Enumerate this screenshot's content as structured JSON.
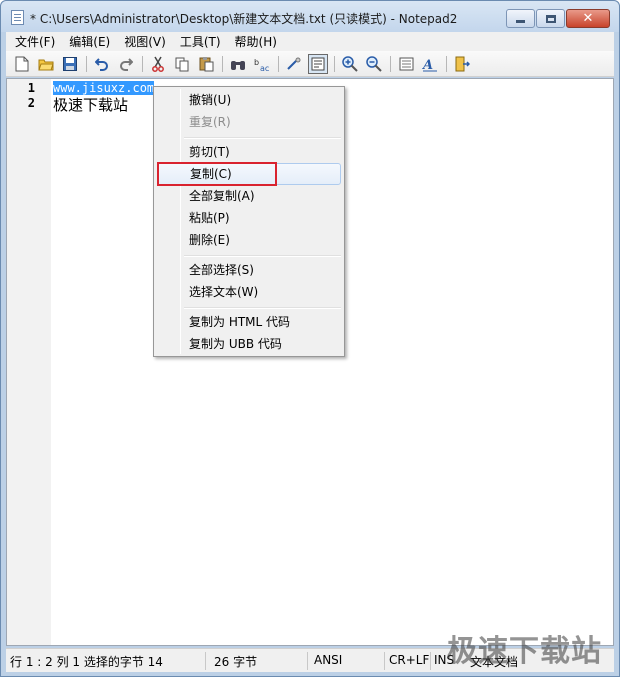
{
  "window": {
    "title": "* C:\\Users\\Administrator\\Desktop\\新建文本文档.txt (只读模式) - Notepad2",
    "close_glyph": "✕"
  },
  "menubar": {
    "items": [
      "文件(F)",
      "编辑(E)",
      "视图(V)",
      "工具(T)",
      "帮助(H)"
    ]
  },
  "toolbar": {
    "icons": [
      "new-file-icon",
      "open-folder-icon",
      "save-icon",
      "undo-icon",
      "redo-icon",
      "cut-icon",
      "copy-icon",
      "paste-icon",
      "find-icon",
      "replace-icon",
      "wrap-icon",
      "view-whitespace-icon",
      "zoom-in-icon",
      "zoom-out-icon",
      "scheme-icon",
      "font-icon",
      "exit-icon"
    ]
  },
  "editor": {
    "lines": [
      {
        "num": "1",
        "text": "www.jisuxz.com",
        "selected": true
      },
      {
        "num": "2",
        "text": "极速下载站",
        "selected": false
      }
    ]
  },
  "context_menu": {
    "items": [
      {
        "label": "撤销(U)",
        "disabled": false
      },
      {
        "label": "重复(R)",
        "disabled": true
      },
      {
        "label": "剪切(T)",
        "disabled": false
      },
      {
        "label": "复制(C)",
        "disabled": false,
        "highlighted": true
      },
      {
        "label": "全部复制(A)",
        "disabled": false
      },
      {
        "label": "粘贴(P)",
        "disabled": false
      },
      {
        "label": "删除(E)",
        "disabled": false
      },
      {
        "label": "全部选择(S)",
        "disabled": false
      },
      {
        "label": "选择文本(W)",
        "disabled": false
      },
      {
        "label": "复制为 HTML 代码",
        "disabled": false
      },
      {
        "label": "复制为 UBB 代码",
        "disabled": false
      }
    ]
  },
  "statusbar": {
    "position": "行 1 : 2   列 1   选择的字节 14",
    "size": "26 字节",
    "encoding": "ANSI",
    "eol": "CR+LF",
    "ins": "INS",
    "doc_type": "文本文档"
  },
  "watermark": "极速下载站",
  "colors": {
    "selection": "#3399ff",
    "highlight_box": "#d9232f",
    "title_bar": "#c9d9ee"
  }
}
